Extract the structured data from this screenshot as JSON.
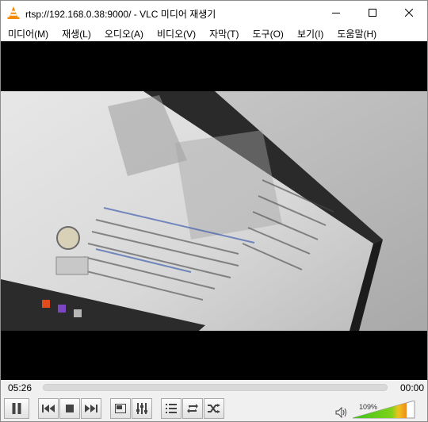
{
  "window": {
    "title": "rtsp://192.168.0.38:9000/ - VLC 미디어 재생기",
    "icon": "vlc-cone-icon"
  },
  "menu": [
    "미디어(M)",
    "재생(L)",
    "오디오(A)",
    "비디오(V)",
    "자막(T)",
    "도구(O)",
    "보기(I)",
    "도움말(H)"
  ],
  "playback": {
    "elapsed": "05:26",
    "total": "00:00"
  },
  "volume": {
    "label": "109%",
    "level": 1.09
  },
  "colors": {
    "video_bg": "#000000",
    "volume_green": "#3ec11e",
    "volume_orange": "#f08a1c"
  }
}
